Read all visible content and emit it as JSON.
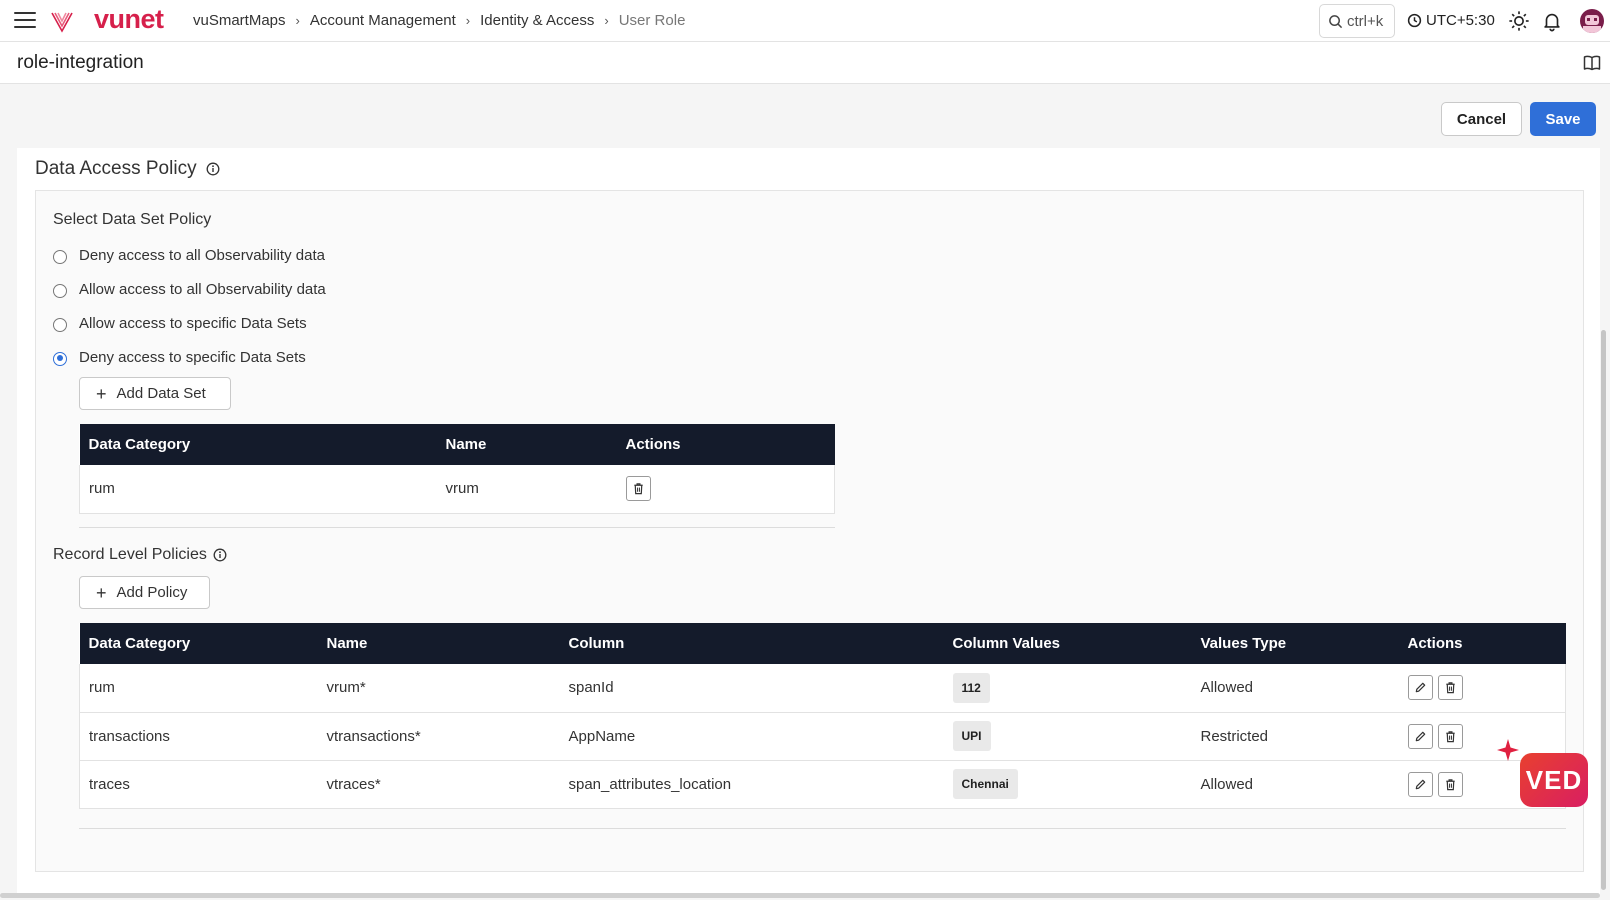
{
  "app": {
    "logo_text": "vunet",
    "breadcrumb": [
      {
        "label": "vuSmartMaps"
      },
      {
        "label": "Account Management"
      },
      {
        "label": "Identity & Access"
      },
      {
        "label": "User Role"
      }
    ],
    "search_shortcut": "ctrl+k",
    "timezone": "UTC+5:30"
  },
  "page": {
    "title": "role-integration",
    "cancel_label": "Cancel",
    "save_label": "Save"
  },
  "data_access_policy": {
    "title": "Data Access Policy",
    "select_title": "Select Data Set Policy",
    "options": [
      {
        "label": "Deny access to all Observability data",
        "selected": false
      },
      {
        "label": "Allow access to all Observability data",
        "selected": false
      },
      {
        "label": "Allow access to specific Data Sets",
        "selected": false
      },
      {
        "label": "Deny access to specific Data Sets",
        "selected": true
      }
    ],
    "add_dataset_label": "Add Data Set",
    "dataset_table": {
      "headers": [
        "Data Category",
        "Name",
        "Actions"
      ],
      "rows": [
        {
          "category": "rum",
          "name": "vrum"
        }
      ]
    }
  },
  "record_level": {
    "title": "Record Level Policies",
    "add_policy_label": "Add Policy",
    "headers": [
      "Data Category",
      "Name",
      "Column",
      "Column Values",
      "Values Type",
      "Actions"
    ],
    "rows": [
      {
        "category": "rum",
        "name": "vrum*",
        "column": "spanId",
        "value": "112",
        "type": "Allowed"
      },
      {
        "category": "transactions",
        "name": "vtransactions*",
        "column": "AppName",
        "value": "UPI",
        "type": "Restricted"
      },
      {
        "category": "traces",
        "name": "vtraces*",
        "column": "span_attributes_location",
        "value": "Chennai",
        "type": "Allowed"
      }
    ]
  },
  "assistant": {
    "badge_text": "VED"
  },
  "colors": {
    "brand": "#d6204b",
    "primary": "#2f6fd8",
    "table_header": "#141b2b"
  },
  "icons": [
    "menu-icon",
    "logo-icon",
    "search-icon",
    "clock-icon",
    "sun-icon",
    "bell-icon",
    "avatar",
    "book-icon",
    "info-icon",
    "plus-icon",
    "trash-icon",
    "edit-icon",
    "sparkle-icon"
  ]
}
